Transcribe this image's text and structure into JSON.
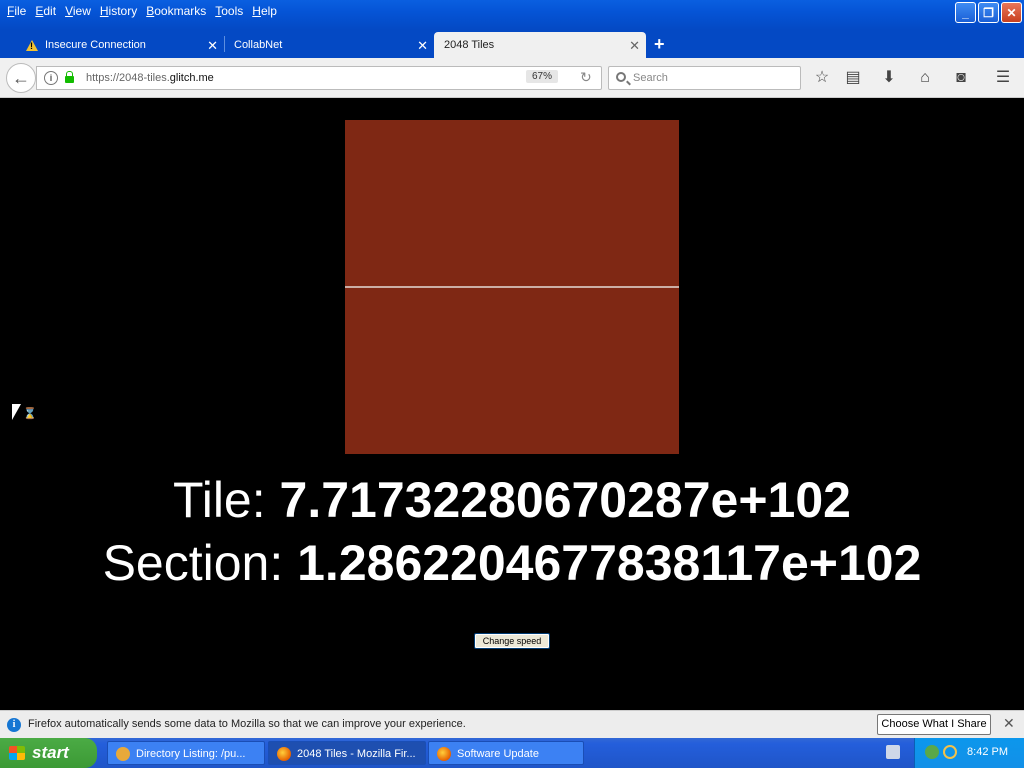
{
  "menu": [
    {
      "acc": "F",
      "rest": "ile"
    },
    {
      "acc": "E",
      "rest": "dit"
    },
    {
      "acc": "V",
      "rest": "iew"
    },
    {
      "acc": "H",
      "rest": "istory"
    },
    {
      "acc": "B",
      "rest": "ookmarks"
    },
    {
      "acc": "T",
      "rest": "ools"
    },
    {
      "acc": "H",
      "rest": "elp"
    }
  ],
  "tabs": [
    {
      "label": "Insecure Connection"
    },
    {
      "label": "CollabNet"
    },
    {
      "label": "2048 Tiles"
    }
  ],
  "url": {
    "prefix": "https://2048-tiles.",
    "domain": "glitch.me",
    "zoom": "67%"
  },
  "search": {
    "placeholder": "Search"
  },
  "page": {
    "tile_label": "Tile: ",
    "tile_value": "7.71732280670287e+102",
    "section_label": "Section: ",
    "section_value": "1.2862204677838117e+102",
    "speed_button": "Change speed",
    "canvas_color": "#7f2814"
  },
  "notification": {
    "text": "Firefox automatically sends some data to Mozilla so that we can improve your experience.",
    "button": "Choose What I Share"
  },
  "taskbar": {
    "start": "start",
    "tasks": [
      {
        "label": "Directory Listing: /pu..."
      },
      {
        "label": "2048 Tiles - Mozilla Fir..."
      },
      {
        "label": "Software Update"
      }
    ],
    "time": "8:42 PM"
  }
}
